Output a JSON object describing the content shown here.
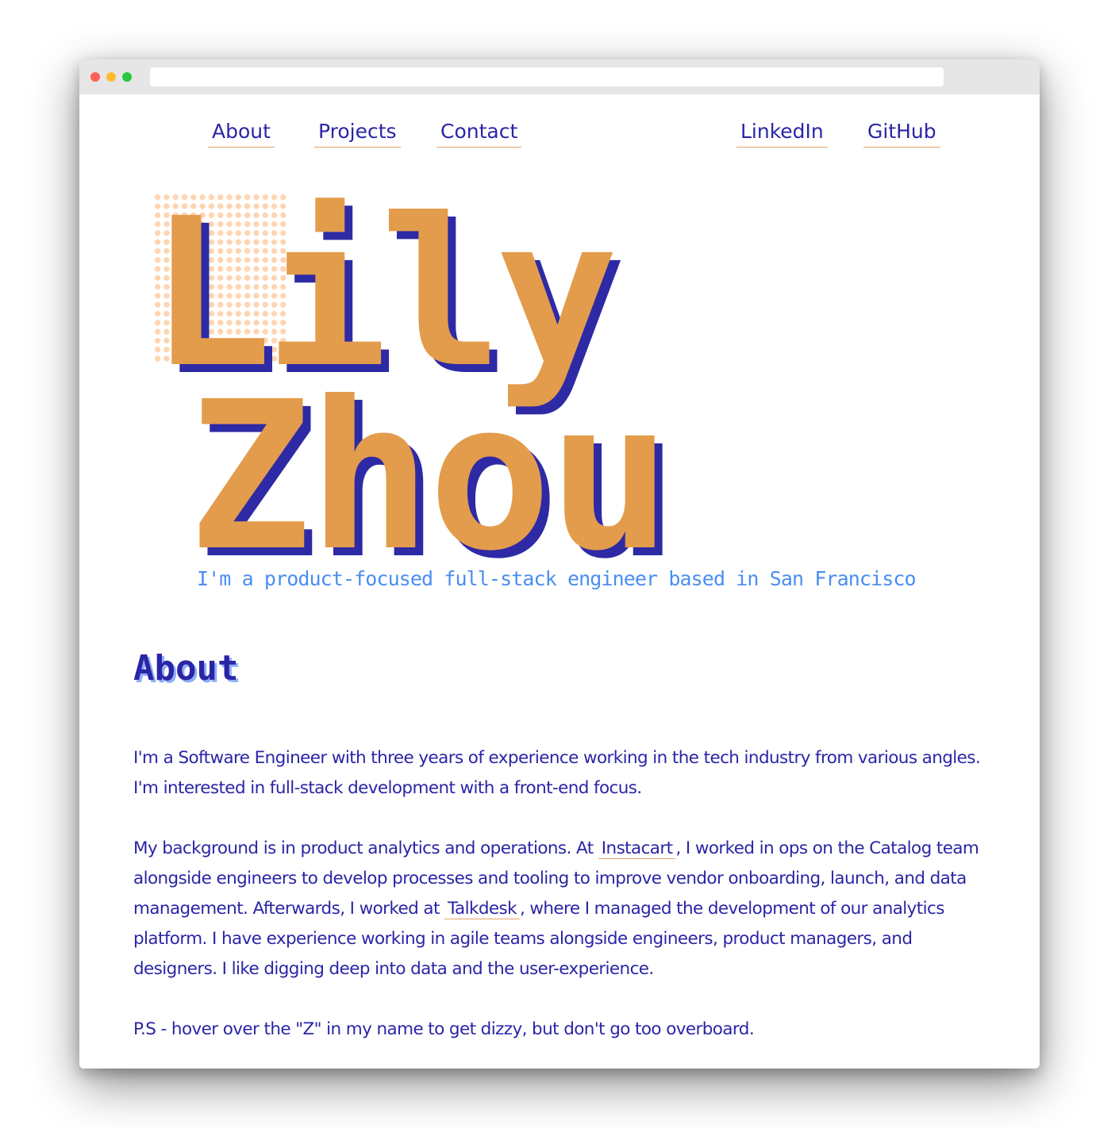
{
  "nav": {
    "left": [
      "About",
      "Projects",
      "Contact"
    ],
    "right": [
      "LinkedIn",
      "GitHub"
    ]
  },
  "hero": {
    "first_name": "Lily",
    "last_name": "Zhou",
    "tagline": "I'm a product-focused full-stack engineer based in San Francisco"
  },
  "about": {
    "heading": "About",
    "p1": "I'm a Software Engineer with three years of experience working in the tech industry from various angles. I'm interested in full-stack development with a front-end focus.",
    "p2_part1": "My background is in product analytics and operations. At ",
    "p2_link1": "Instacart",
    "p2_part2": ", I worked in ops on the Catalog team alongside engineers to develop processes and tooling to improve vendor onboarding, launch, and data management. Afterwards, I worked at ",
    "p2_link2": "Talkdesk",
    "p2_part3": ", where I managed the development of our analytics platform. I have experience working in agile teams alongside engineers, product managers, and designers. I like digging deep into data and the user-experience.",
    "p3": "P.S - hover over the \"Z\" in my name to get dizzy, but don't go too overboard."
  },
  "colors": {
    "text": "#2a25a6",
    "accent_orange": "#e39c4c",
    "shadow_blue": "#2e2aa5",
    "tagline_blue": "#4a8ef0",
    "dots_peach": "#ffd4b0",
    "underline": "#e2a470"
  }
}
